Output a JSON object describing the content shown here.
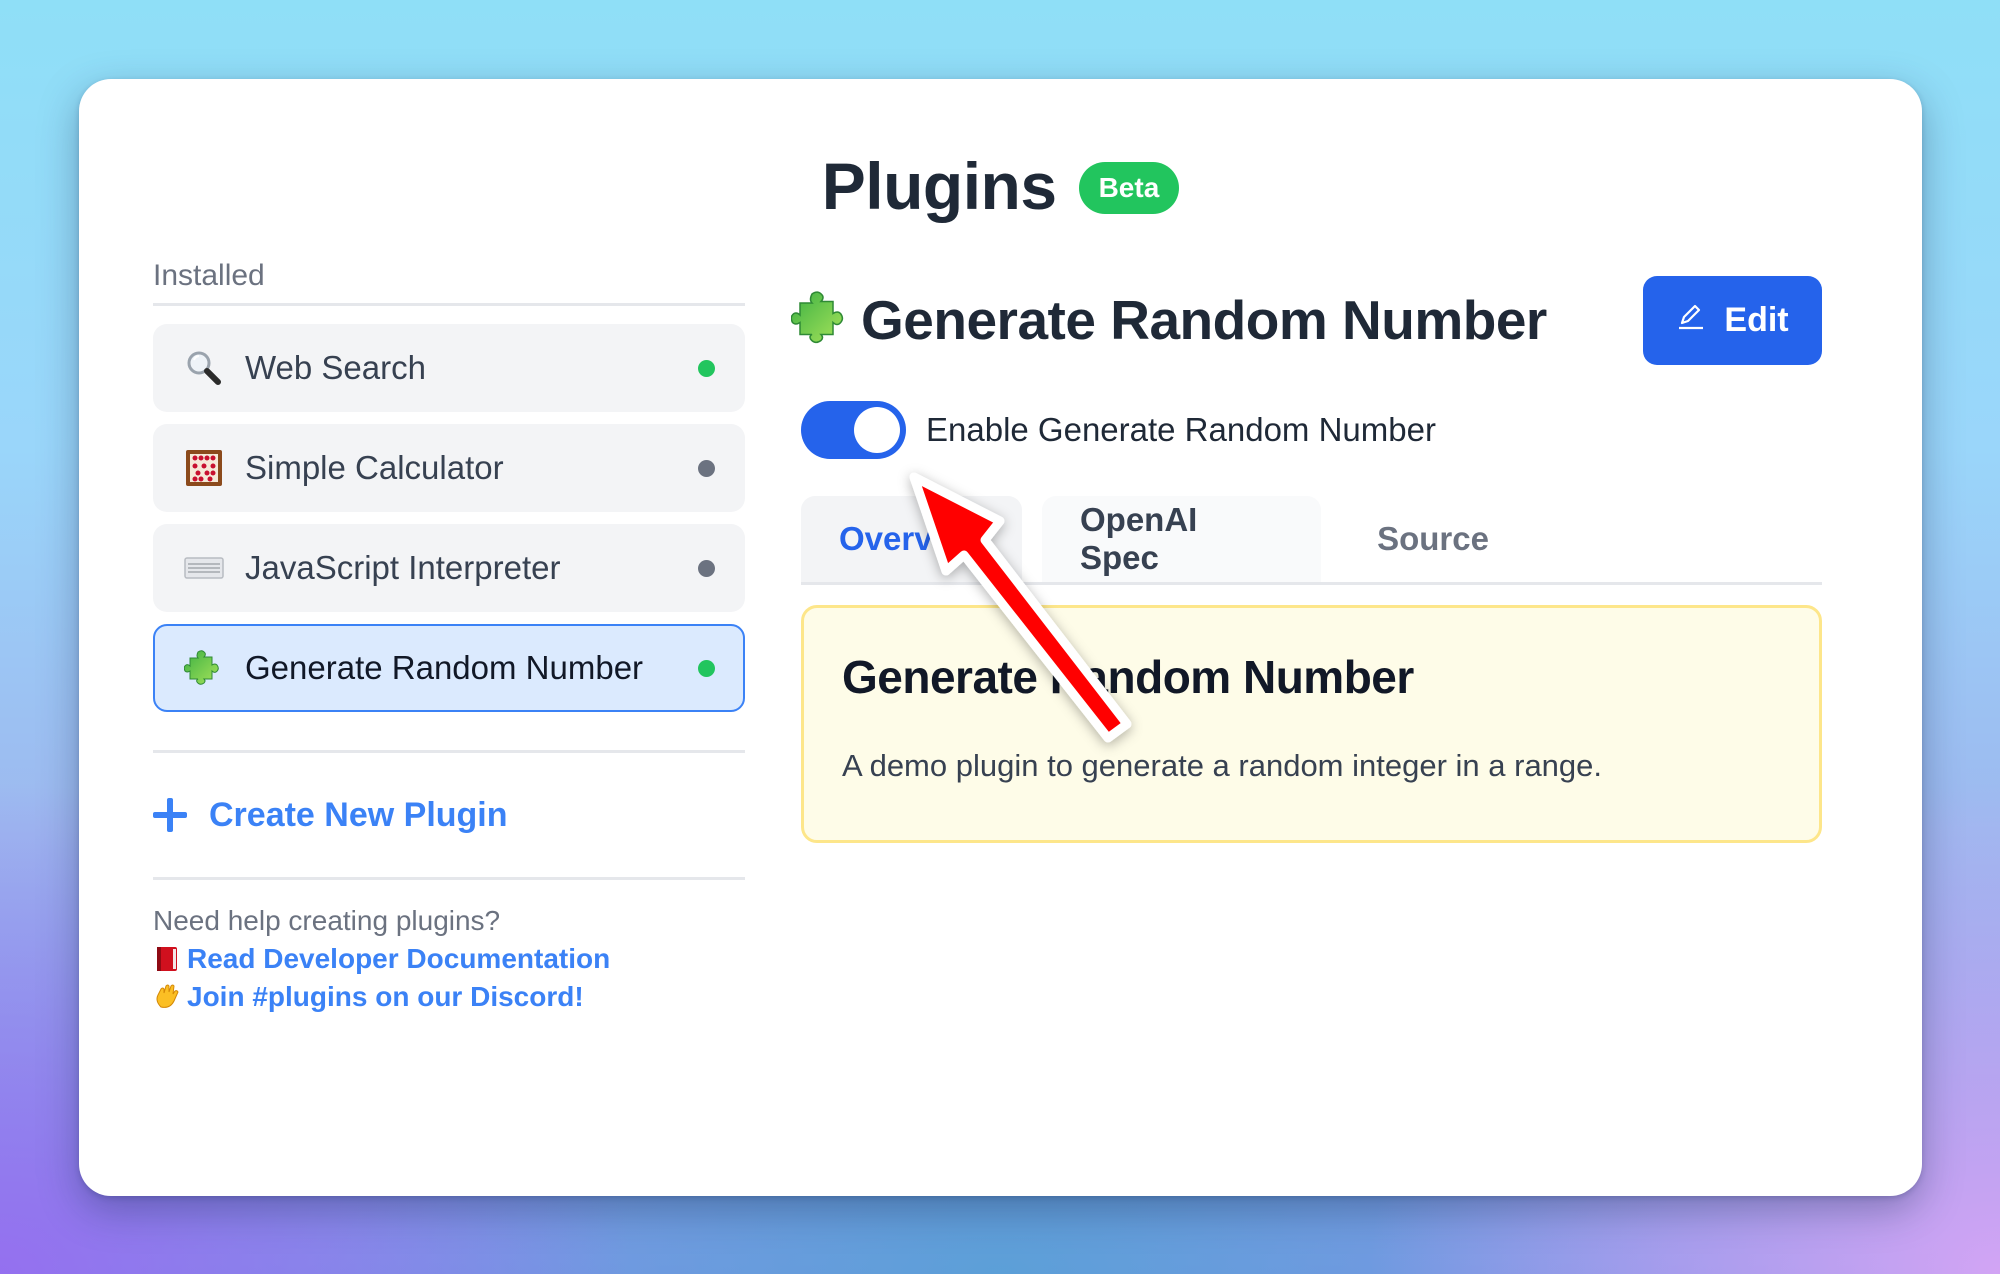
{
  "page": {
    "title": "Plugins",
    "badge": "Beta"
  },
  "sidebar": {
    "section_label": "Installed",
    "items": [
      {
        "icon": "magnifying-glass-icon",
        "label": "Web Search",
        "status": "active",
        "selected": false
      },
      {
        "icon": "abacus-icon",
        "label": "Simple Calculator",
        "status": "inactive",
        "selected": false
      },
      {
        "icon": "keyboard-icon",
        "label": "JavaScript Interpreter",
        "status": "inactive",
        "selected": false
      },
      {
        "icon": "puzzle-piece-icon",
        "label": "Generate Random Number",
        "status": "active",
        "selected": true
      }
    ],
    "create_label": "Create New Plugin",
    "help_text": "Need help creating plugins?",
    "links": [
      {
        "icon": "red-book-icon",
        "label": "Read Developer Documentation"
      },
      {
        "icon": "waving-hand-icon",
        "label": "Join #plugins on our Discord!"
      }
    ]
  },
  "detail": {
    "icon": "puzzle-piece-icon",
    "title": "Generate Random Number",
    "edit_label": "Edit",
    "toggle_label": "Enable Generate Random Number",
    "toggle_on": true,
    "tabs": [
      {
        "label": "Overview",
        "active": true
      },
      {
        "label": "OpenAI Spec",
        "active": false
      },
      {
        "label": "Source",
        "active": false
      }
    ],
    "overview": {
      "heading": "Generate Random Number",
      "description": "A demo plugin to generate a random integer in a range."
    }
  },
  "annotation": {
    "type": "arrow",
    "color": "#ff0000",
    "points_to": "enable-toggle"
  },
  "colors": {
    "accent": "#2563eb",
    "link": "#3b82f6",
    "status_active": "#22c55e",
    "status_inactive": "#6b7280",
    "beta_badge": "#22c55e",
    "overview_bg": "#fefce8"
  }
}
